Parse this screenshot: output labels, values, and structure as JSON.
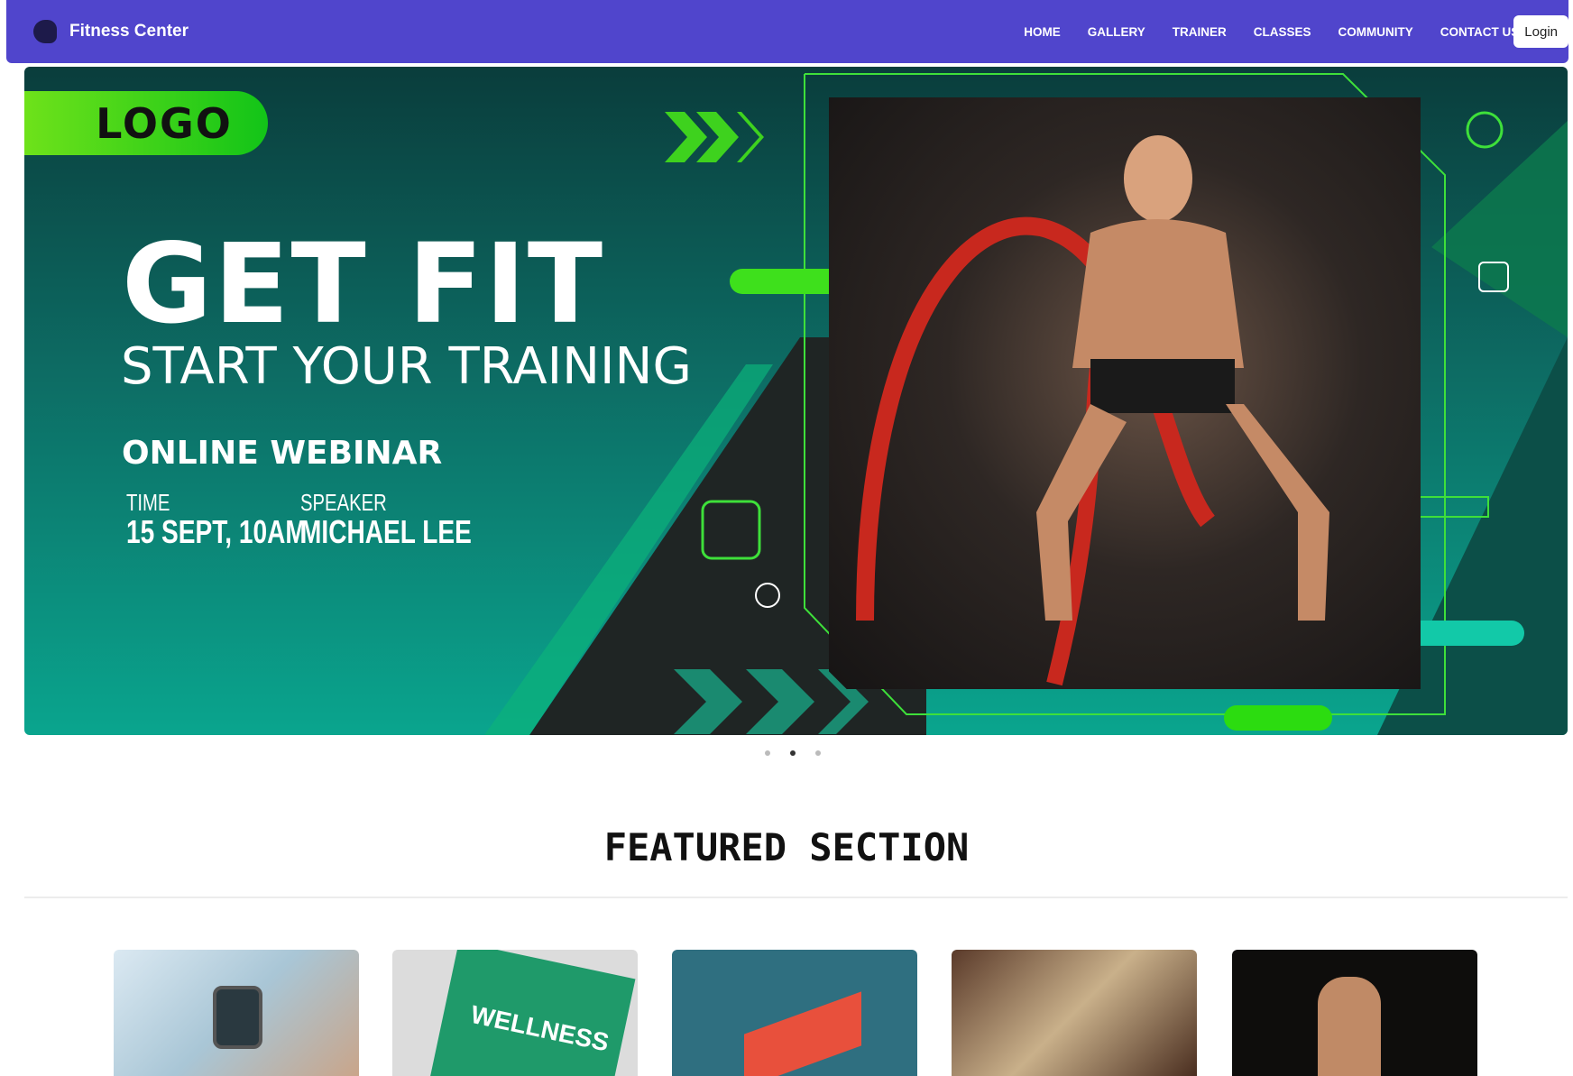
{
  "navbar": {
    "brand": "Fitness Center",
    "items": [
      "HOME",
      "GALLERY",
      "TRAINER",
      "CLASSES",
      "COMMUNITY",
      "CONTACT US"
    ],
    "login": "Login",
    "color": "#5045cc"
  },
  "banner": {
    "logo": "LOGO",
    "headline": "GET FIT",
    "subheadline": "START YOUR TRAINING",
    "event": "ONLINE WEBINAR",
    "time_label": "TIME",
    "time_value": "15 SEPT, 10AM",
    "speaker_label": "SPEAKER",
    "speaker_value": "MICHAEL LEE",
    "slides": 3,
    "active_slide": 2
  },
  "featured": {
    "title": "FEATURED SECTION",
    "cards": [
      {
        "image": "smartwatch"
      },
      {
        "image": "wellness"
      },
      {
        "image": "sleep-analysis"
      },
      {
        "image": "map-planning"
      },
      {
        "image": "athlete-stretching"
      }
    ],
    "card_text": {
      "wellness": "WELLNESS"
    }
  }
}
